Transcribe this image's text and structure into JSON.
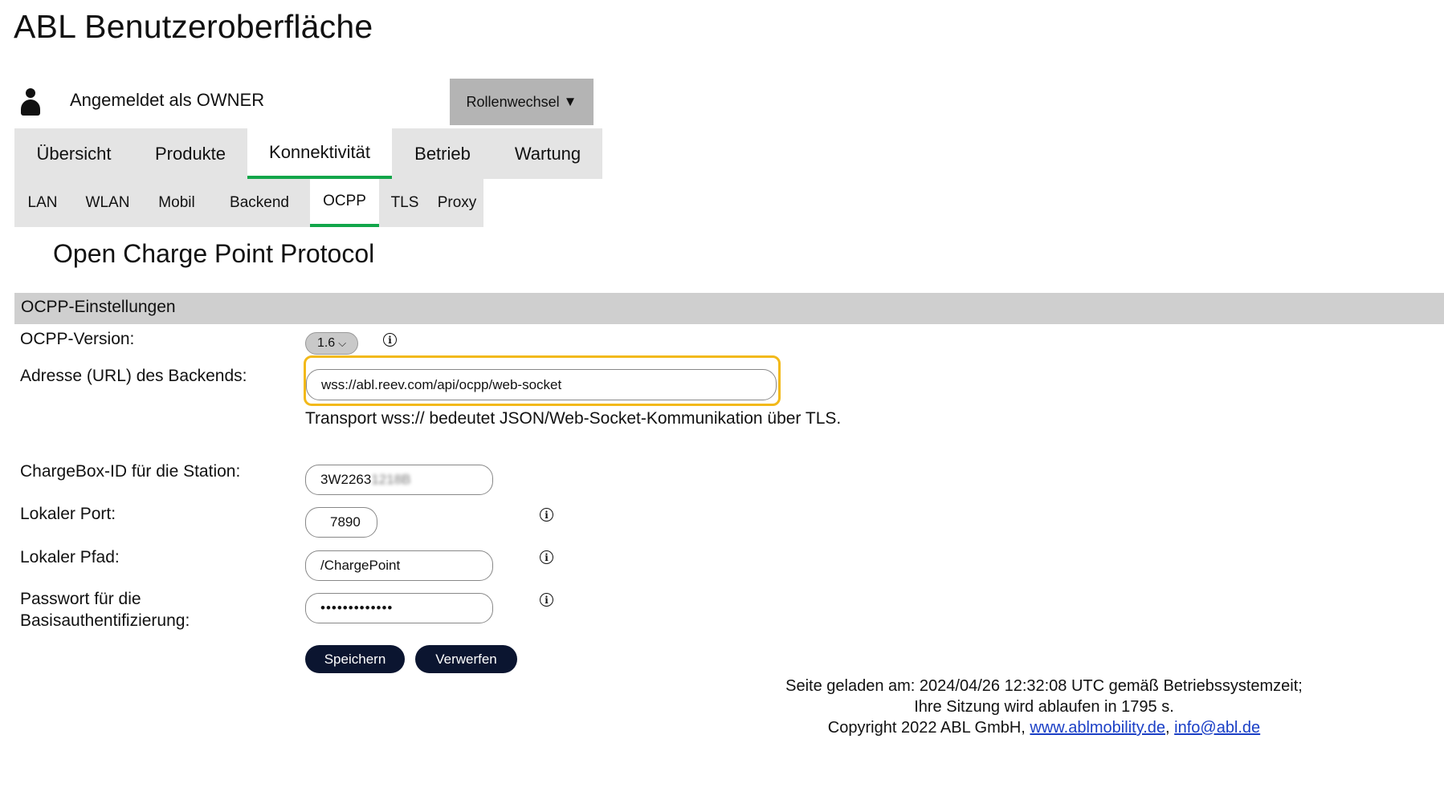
{
  "app": {
    "title": "ABL Benutzeroberfläche"
  },
  "user": {
    "label": "Angemeldet als OWNER",
    "icon": "user-icon"
  },
  "role_switch": {
    "label": "Rollenwechsel",
    "caret": "▼"
  },
  "main_tabs": [
    {
      "label": "Übersicht",
      "active": false
    },
    {
      "label": "Produkte",
      "active": false
    },
    {
      "label": "Konnektivität",
      "active": true
    },
    {
      "label": "Betrieb",
      "active": false
    },
    {
      "label": "Wartung",
      "active": false
    }
  ],
  "sub_tabs": [
    {
      "label": "LAN",
      "active": false
    },
    {
      "label": "WLAN",
      "active": false
    },
    {
      "label": "Mobil",
      "active": false
    },
    {
      "label": "Backend",
      "active": false
    },
    {
      "label": "OCPP",
      "active": true
    },
    {
      "label": "TLS",
      "active": false
    },
    {
      "label": "Proxy",
      "active": false
    }
  ],
  "page_title": "Open Charge Point Protocol",
  "section": {
    "title": "OCPP-Einstellungen"
  },
  "form": {
    "version": {
      "label": "OCPP-Version:",
      "value": "1.6",
      "chevron": "⌵"
    },
    "url": {
      "label": "Adresse (URL) des Backends:",
      "value": "wss://abl.reev.com/api/ocpp/web-socket",
      "hint": "Transport wss:// bedeutet JSON/Web-Socket-Kommunikation über TLS."
    },
    "chargebox": {
      "label": "ChargeBox-ID für die Station:",
      "value_visible": "3W2263",
      "value_blurred": "1218B"
    },
    "port": {
      "label": "Lokaler Port:",
      "value": "7890"
    },
    "path": {
      "label": "Lokaler Pfad:",
      "value": "/ChargePoint"
    },
    "password": {
      "label_line1": "Passwort für die",
      "label_line2": "Basisauthentifizierung:",
      "value": "•••••••••••••"
    },
    "info_glyph": "i"
  },
  "buttons": {
    "save": "Speichern",
    "discard": "Verwerfen"
  },
  "footer": {
    "line1": "Seite geladen am: 2024/04/26 12:32:08 UTC gemäß Betriebssystemzeit;",
    "line2": "Ihre Sitzung wird ablaufen in 1795 s.",
    "copyright": "Copyright 2022 ABL GmbH, ",
    "separator": ", ",
    "link_web": "www.ablmobility.de",
    "link_mail": "info@abl.de"
  },
  "colors": {
    "accent": "#12a64a",
    "focus": "#f2b91a",
    "button_dark": "#0b1530",
    "tab_bg": "#e4e4e4",
    "section_bg": "#cfcfcf",
    "link": "#1a3fc6"
  }
}
